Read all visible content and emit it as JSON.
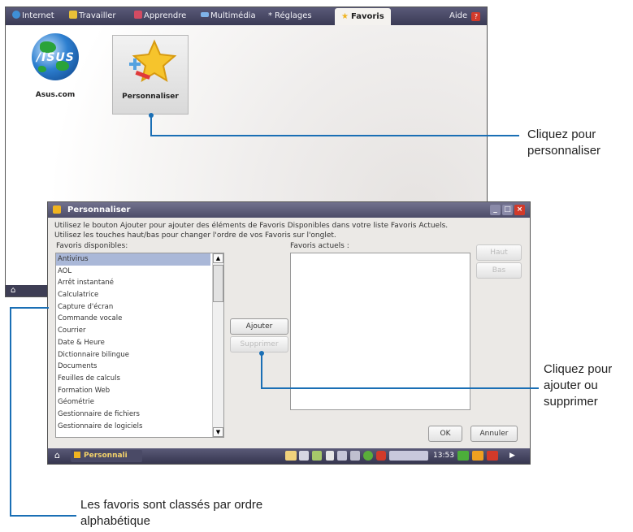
{
  "screen1": {
    "tabs": [
      {
        "label": "Internet",
        "icon": "globe-icon",
        "color": "#3f8fd6"
      },
      {
        "label": "Travailler",
        "icon": "work-icon",
        "color": "#e8c038"
      },
      {
        "label": "Apprendre",
        "icon": "book-icon",
        "color": "#d24b62"
      },
      {
        "label": "Multimédia",
        "icon": "media-icon",
        "color": "#7fb3e8"
      },
      {
        "label": "Réglages",
        "icon": "settings-icon",
        "color": "#c8c8c8"
      },
      {
        "label": "Favoris",
        "icon": "star-icon",
        "color": "#f0b420"
      }
    ],
    "help_label": "Aide",
    "apps": [
      {
        "label": "Asus.com"
      },
      {
        "label": "Personnaliser"
      }
    ],
    "asus_logo_text": "/ISUS"
  },
  "dialog": {
    "title": "Personnaliser",
    "info_line1": "Utilisez le bouton Ajouter pour ajouter des éléments de Favoris Disponibles dans votre liste Favoris Actuels.",
    "info_line2": "Utilisez les touches haut/bas pour changer l'ordre de vos Favoris sur l'onglet.",
    "available_label": "Favoris disponibles:",
    "current_label": "Favoris actuels :",
    "available_items": [
      "Antivirus",
      "AOL",
      "Arrêt instantané",
      "Calculatrice",
      "Capture d'écran",
      "Commande vocale",
      "Courrier",
      "Date & Heure",
      "Dictionnaire bilingue",
      "Documents",
      "Feuilles de calculs",
      "Formation Web",
      "Géométrie",
      "Gestionnaire de fichiers",
      "Gestionnaire de logiciels"
    ],
    "add_button": "Ajouter",
    "remove_button": "Supprimer",
    "up_button": "Haut",
    "down_button": "Bas",
    "ok_button": "OK",
    "cancel_button": "Annuler",
    "taskbar_app": "Personnali",
    "taskbar_clock": "13:53"
  },
  "callouts": {
    "customize": [
      "Cliquez pour",
      "personnaliser"
    ],
    "add_remove": [
      "Cliquez pour",
      "ajouter ou",
      "supprimer"
    ],
    "sorted": [
      "Les favoris sont classés par ordre",
      "alphabétique"
    ]
  },
  "colors": {
    "callout_line": "#1a6fb5",
    "titlebar": "#5a5a78",
    "selection": "#aab8d8"
  }
}
